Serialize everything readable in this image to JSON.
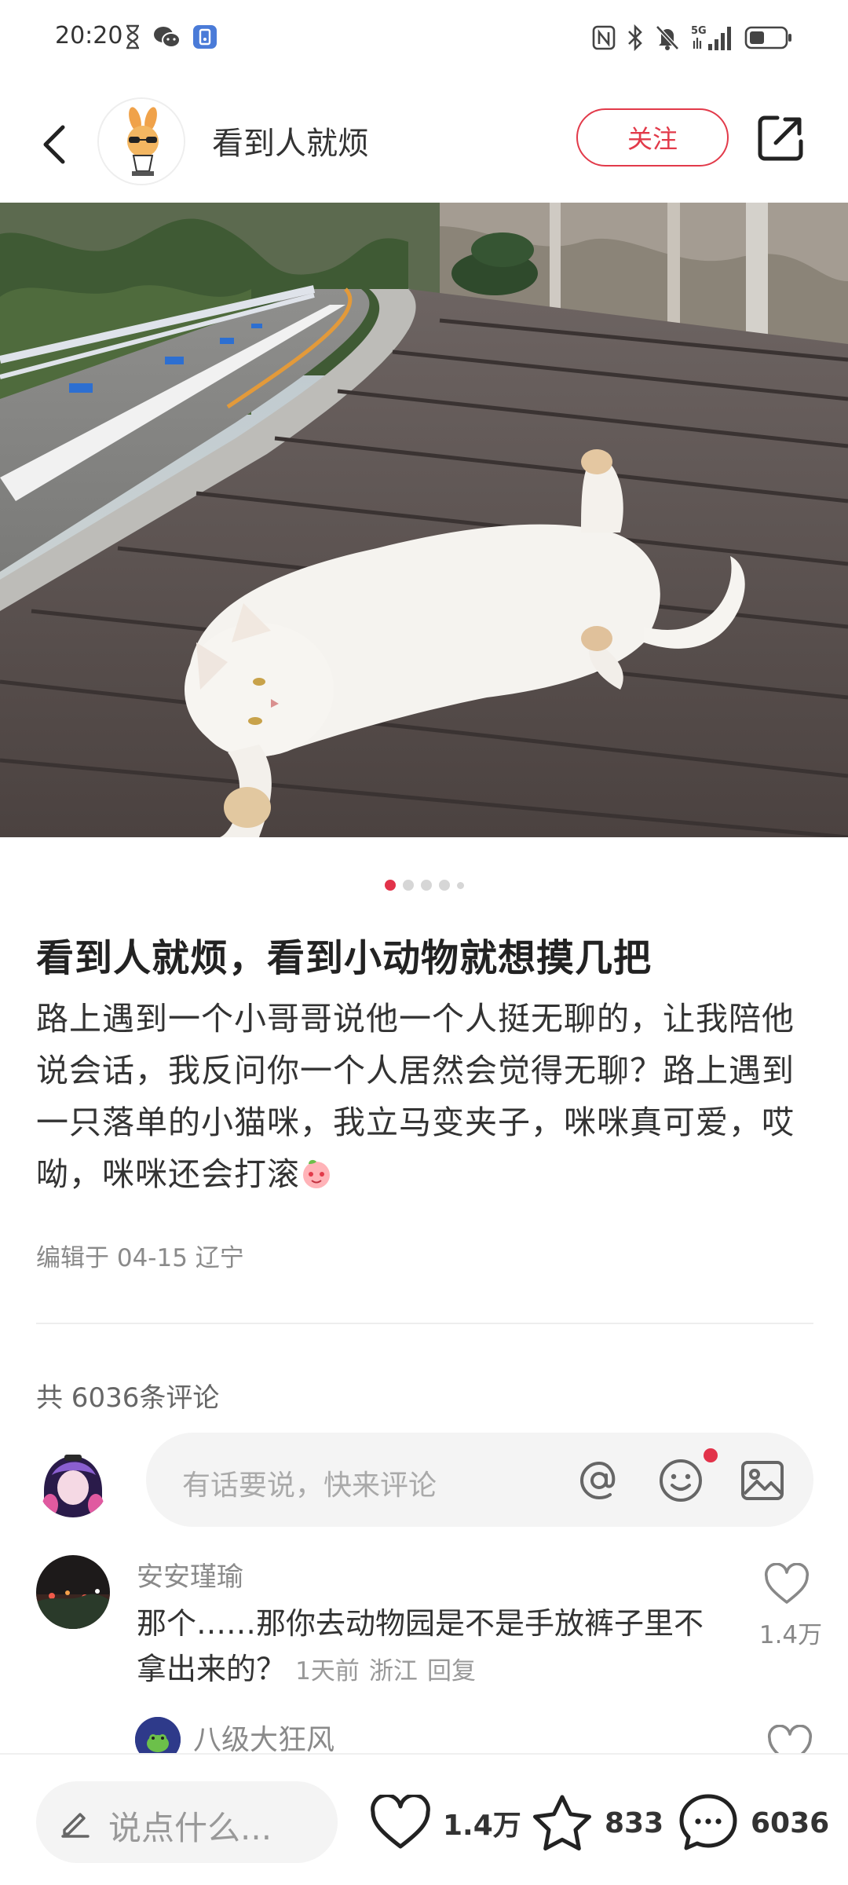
{
  "status_bar": {
    "time": "20:20",
    "left_icons": [
      "hourglass-icon",
      "wechat-icon",
      "app-icon"
    ],
    "right_icons": [
      "nfc-icon",
      "bluetooth-icon",
      "mute-icon",
      "5g-signal-icon",
      "battery-icon"
    ],
    "network": "5G"
  },
  "header": {
    "author_name": "看到人就烦",
    "follow_label": "关注"
  },
  "carousel": {
    "total": 5,
    "active_index": 0
  },
  "post": {
    "title": "看到人就烦，看到小动物就想摸几把",
    "body": "路上遇到一个小哥哥说他一个人挺无聊的，让我陪他说会话，我反问你一个人居然会觉得无聊？路上遇到一只落单的小猫咪，我立马变夹子，咪咪真可爱，哎呦，咪咪还会打滚",
    "meta": "编辑于 04-15 辽宁"
  },
  "comments": {
    "count_label": "共 6036条评论",
    "input_placeholder": "有话要说，快来评论",
    "items": [
      {
        "user": "安安瑾瑜",
        "text": "那个……那你去动物园是不是手放裤子里不拿出来的？",
        "time": "1天前",
        "location": "浙江",
        "reply": "回复",
        "likes": "1.4万"
      }
    ],
    "reply_preview": {
      "user": "八级大狂风"
    }
  },
  "bottom_bar": {
    "input_label": "说点什么...",
    "like_count": "1.4万",
    "star_count": "833",
    "comment_count": "6036"
  },
  "colors": {
    "accent": "#e23a4a",
    "text": "#222222",
    "muted": "#8a8a8a",
    "input_bg": "#f4f4f4"
  }
}
